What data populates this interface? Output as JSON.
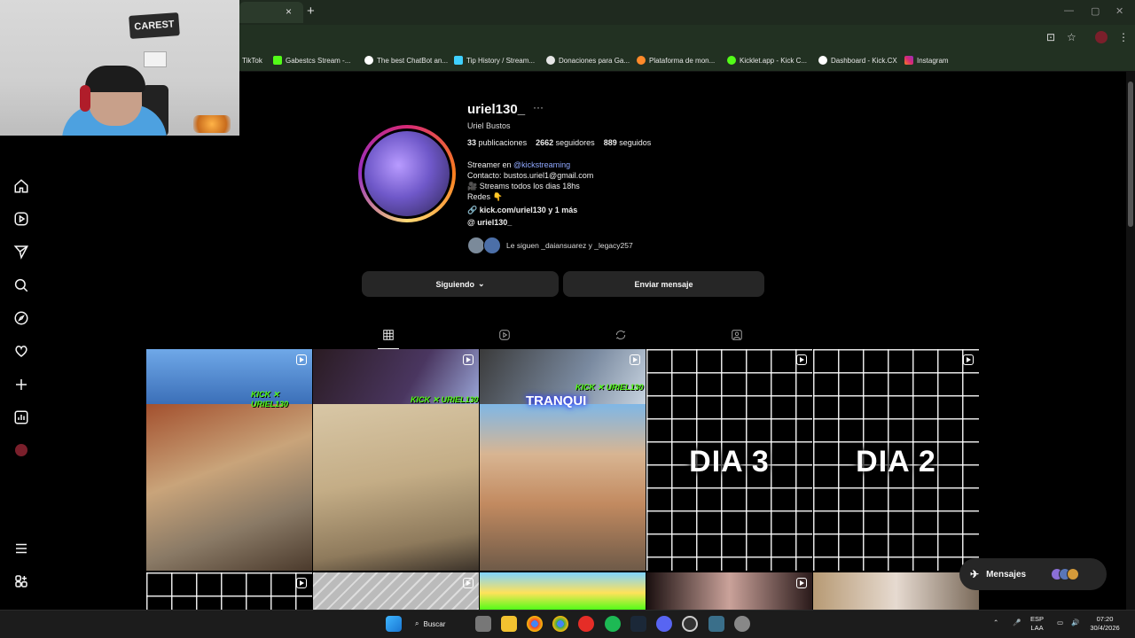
{
  "browser": {
    "tab_close": "×",
    "new_tab": "+",
    "bookmarks": [
      {
        "label": "TikTok",
        "color": "#000000"
      },
      {
        "label": "Gabestcs Stream -...",
        "color": "#53fc18"
      },
      {
        "label": "The best ChatBot an...",
        "color": "#ffffff"
      },
      {
        "label": "Tip History / Stream...",
        "color": "#3fd0ff"
      },
      {
        "label": "Donaciones para Ga...",
        "color": "#e6e6e6"
      },
      {
        "label": "Plataforma de mon...",
        "color": "#ff8a2a"
      },
      {
        "label": "Kicklet.app - Kick C...",
        "color": "#53fc18"
      },
      {
        "label": "Dashboard - Kick.CX",
        "color": "#ffffff"
      },
      {
        "label": "Instagram",
        "color": "#e1306c"
      }
    ]
  },
  "webcam": {
    "sign_text": "CAREST"
  },
  "profile": {
    "username": "uriel130_",
    "more": "···",
    "full_name": "Uriel Bustos",
    "posts_count": "33",
    "posts_label": "publicaciones",
    "followers_count": "2662",
    "followers_label": "seguidores",
    "following_count": "889",
    "following_label": "seguidos",
    "bio_line1_prefix": "Streamer en ",
    "bio_line1_mention": "@kickstreaming",
    "bio_line2": "Contacto: bustos.uriel1@gmail.com",
    "bio_line3": "🎥 Streams todos los dias 18hs",
    "bio_line4": "Redes 👇",
    "link": "kick.com/uriel130 y 1 más",
    "threads": "uriel130_",
    "followed_by": "Le siguen _daiansuarez y _legacy257",
    "follow_button": "Siguiendo",
    "message_button": "Enviar mensaje"
  },
  "grid": {
    "posts": [
      {
        "kind": "clip",
        "kick_tag": "KICK ✕ URIEL130"
      },
      {
        "kind": "clip",
        "kick_tag": "KICK ✕ URIEL130"
      },
      {
        "kind": "clip",
        "kick_tag": "KICK ✕ URIEL130",
        "caption": "TRANQUI"
      },
      {
        "kind": "text",
        "caption": "DIA 3"
      },
      {
        "kind": "text",
        "caption": "DIA 2"
      }
    ]
  },
  "messages": {
    "label": "Mensajes"
  },
  "taskbar": {
    "search_label": "Buscar",
    "lang": "ESP",
    "lang2": "LAA",
    "time": "07:20",
    "date": "30/4/2026"
  },
  "colors": {
    "accent_link": "#8fa8ff",
    "kick_green": "#53fc18",
    "button_bg": "#262626"
  }
}
